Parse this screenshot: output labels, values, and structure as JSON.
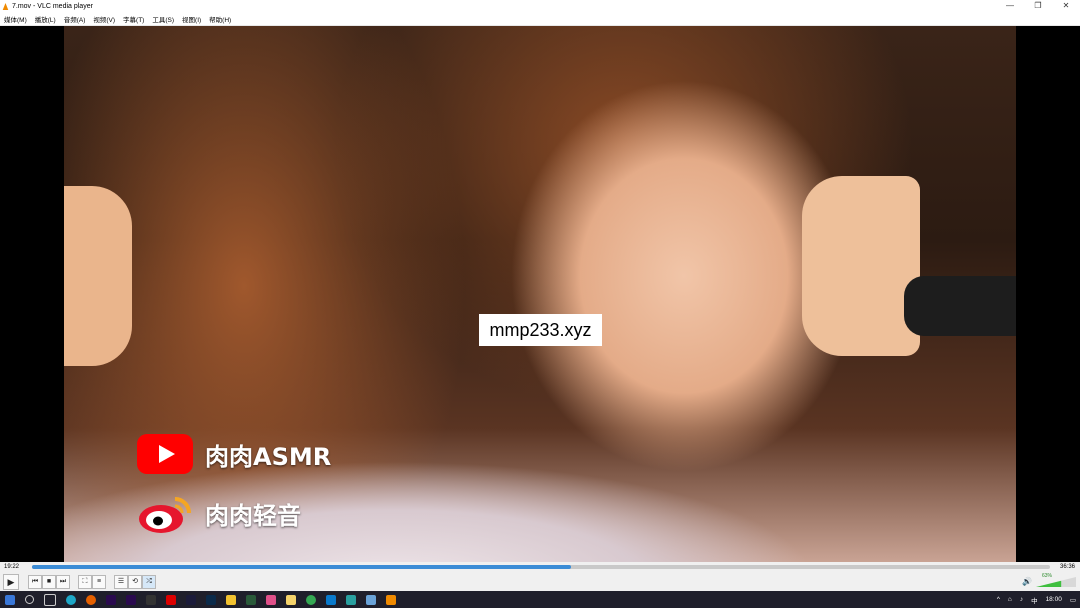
{
  "window": {
    "title": "7.mov - VLC media player",
    "minimize_icon": "—",
    "maximize_icon": "❐",
    "close_icon": "✕"
  },
  "menu": [
    "媒体(M)",
    "播放(L)",
    "音频(A)",
    "视频(V)",
    "字幕(T)",
    "工具(S)",
    "视图(I)",
    "帮助(H)"
  ],
  "video": {
    "watermark": "mmp233.xyz",
    "youtube_label": "肉肉ASMR",
    "weibo_label": "肉肉轻音"
  },
  "playback": {
    "elapsed": "19:22",
    "total": "36:36",
    "progress": 0.529
  },
  "volume": {
    "label": "63%",
    "level": 0.63
  },
  "controls": {
    "play": "▶",
    "prev": "⏮",
    "stop": "■",
    "next": "⏭",
    "fullscreen": "⛶",
    "extended": "≡",
    "playlist": "☰",
    "loop": "⟲",
    "random": "⤮"
  },
  "taskbar": {
    "icons": [
      "start-icon",
      "search-icon",
      "task-view-icon",
      "edge-icon",
      "firefox-icon",
      "premiere-icon",
      "premiere-icon-2",
      "davinci-icon",
      "acrobat-icon",
      "ae-icon",
      "photoshop-icon",
      "folder-icon",
      "terminal-icon",
      "game-icon",
      "file-explorer-icon",
      "chrome-icon",
      "vscode-icon",
      "screenshot-icon",
      "app-icon",
      "vlc-icon"
    ],
    "time": "18:00",
    "ime": "中"
  }
}
